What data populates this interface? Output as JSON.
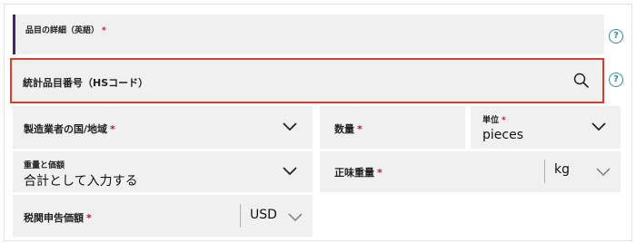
{
  "item_description": {
    "label": "品目の詳細（英語）",
    "required_mark": "*",
    "help": "?"
  },
  "hs_code": {
    "label": "統計品目番号（HSコード）",
    "help": "?",
    "icon": "search-icon"
  },
  "country_of_manufacture": {
    "label": "製造業者の国/地域",
    "required_mark": "*",
    "icon": "chevron-down-icon"
  },
  "quantity": {
    "label": "数量",
    "required_mark": "*"
  },
  "unit": {
    "label": "単位",
    "required_mark": "*",
    "value": "pieces",
    "icon": "chevron-down-icon"
  },
  "weight_and_value": {
    "label": "重量と価額",
    "value": "合計として入力する",
    "icon": "chevron-down-icon"
  },
  "net_weight": {
    "label": "正味重量",
    "required_mark": "*",
    "unit_value": "kg",
    "icon": "chevron-down-icon"
  },
  "customs_value": {
    "label": "税関申告価額",
    "required_mark": "*",
    "currency_value": "USD",
    "icon": "chevron-down-icon"
  },
  "colors": {
    "highlight_border": "#e03a2c",
    "accent_bar": "#3d2a57",
    "field_bg": "#f0f0f0",
    "help_icon": "#3a8a9a",
    "required": "#c8102e"
  }
}
